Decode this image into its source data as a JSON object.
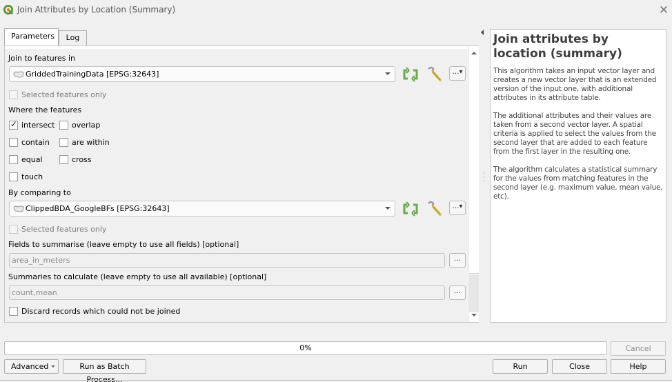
{
  "window": {
    "title": "Join Attributes by Location (Summary)",
    "app_icon": "qgis-logo-icon",
    "close_icon": "close-icon",
    "close_glyph": "✕"
  },
  "tabs": [
    {
      "label": "Parameters",
      "active": true
    },
    {
      "label": "Log",
      "active": false
    }
  ],
  "parameters": {
    "join_to_label": "Join to features in",
    "join_to_layer": "GriddedTrainingData [EPSG:32643]",
    "join_to_selected_only": {
      "label": "Selected features only",
      "checked": false,
      "enabled": false
    },
    "predicate_label": "Where the features",
    "predicates": [
      {
        "label": "intersect",
        "checked": true
      },
      {
        "label": "overlap",
        "checked": false
      },
      {
        "label": "contain",
        "checked": false
      },
      {
        "label": "are within",
        "checked": false
      },
      {
        "label": "equal",
        "checked": false
      },
      {
        "label": "cross",
        "checked": false
      },
      {
        "label": "touch",
        "checked": false
      }
    ],
    "compare_label": "By comparing to",
    "compare_layer": "ClippedBDA_GoogleBFs [EPSG:32643]",
    "compare_selected_only": {
      "label": "Selected features only",
      "checked": false,
      "enabled": false
    },
    "fields_label": "Fields to summarise (leave empty to use all fields) [optional]",
    "fields_value": "area_in_meters",
    "summaries_label": "Summaries to calculate (leave empty to use all available) [optional]",
    "summaries_value": "count,mean",
    "discard_label": "Discard records which could not be joined",
    "discard_checked": false,
    "ellipsis_label": "…",
    "dots_dropdown_label": "…▾",
    "refresh_icon": "iterate-refresh-icon",
    "wrench_icon": "wrench-icon"
  },
  "help": {
    "title": "Join attributes by location (summary)",
    "paragraphs": [
      "This algorithm takes an input vector layer and creates a new vector layer that is an extended version of the input one, with additional attributes in its attribute table.",
      "The additional attributes and their values are taken from a second vector layer. A spatial criteria is applied to select the values from the second layer that are added to each feature from the first layer in the resulting one.",
      "The algorithm calculates a statistical summary for the values from matching features in the second layer (e.g. maximum value, mean value, etc)."
    ]
  },
  "progress": {
    "value_percent": 0,
    "text": "0%"
  },
  "buttons": {
    "cancel": "Cancel",
    "advanced": "Advanced",
    "batch": "Run as Batch Process...",
    "run": "Run",
    "close": "Close",
    "help": "Help"
  }
}
